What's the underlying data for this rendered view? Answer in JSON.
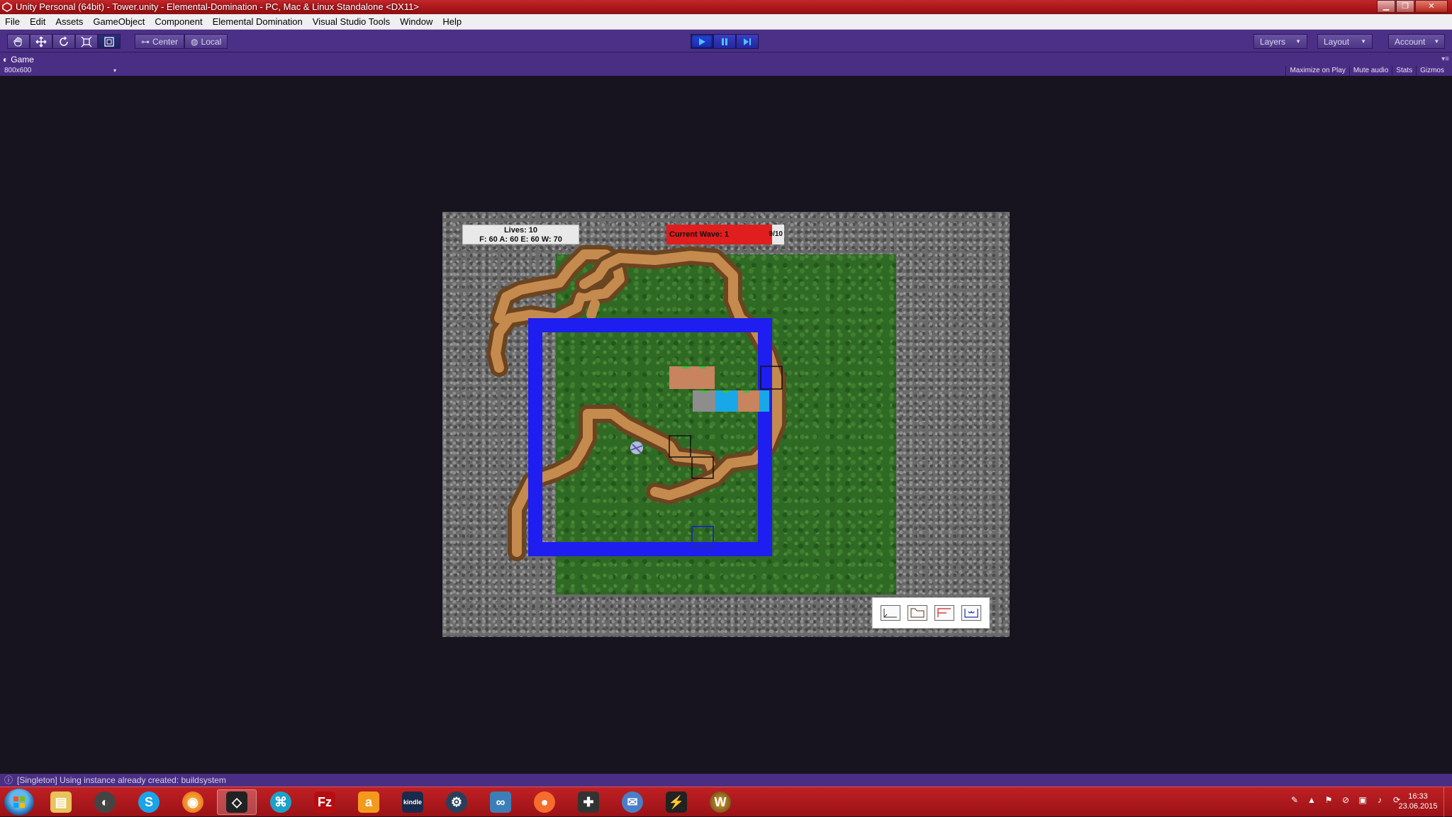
{
  "window": {
    "title": "Unity Personal (64bit) - Tower.unity - Elemental-Domination - PC, Mac & Linux Standalone <DX11>"
  },
  "menu": [
    "File",
    "Edit",
    "Assets",
    "GameObject",
    "Component",
    "Elemental Domination",
    "Visual Studio Tools",
    "Window",
    "Help"
  ],
  "toolbar": {
    "pivot_label": "Center",
    "space_label": "Local",
    "layers_label": "Layers",
    "layout_label": "Layout",
    "account_label": "Account"
  },
  "game_panel": {
    "tab_label": "Game",
    "resolution": "800x600",
    "options": [
      "Maximize on Play",
      "Mute audio",
      "Stats",
      "Gizmos"
    ]
  },
  "hud": {
    "lives": "Lives: 10",
    "resources": "F: 60 A: 60 E: 60 W: 70",
    "wave_label": "Current Wave: 1",
    "wave_count": "9/10",
    "wave_progress": 0.9
  },
  "status": {
    "message": "[Singleton] Using instance already created: buildsystem"
  },
  "taskbar": {
    "apps": [
      "explorer",
      "chrome-like",
      "skype",
      "firefox",
      "unity",
      "sourcetree",
      "filezilla",
      "amazon",
      "kindle",
      "steam",
      "visual-studio",
      "origin",
      "gamepad",
      "thunderbird",
      "winamp",
      "warcraft"
    ],
    "time": "16:33",
    "date": "23.06.2015"
  },
  "colors": {
    "toolbar_bg": "#4c2f86",
    "titlebar_bg": "#b51c20",
    "range_indicator": "#1e1ef0",
    "wave_bar": "#e01e1e"
  }
}
